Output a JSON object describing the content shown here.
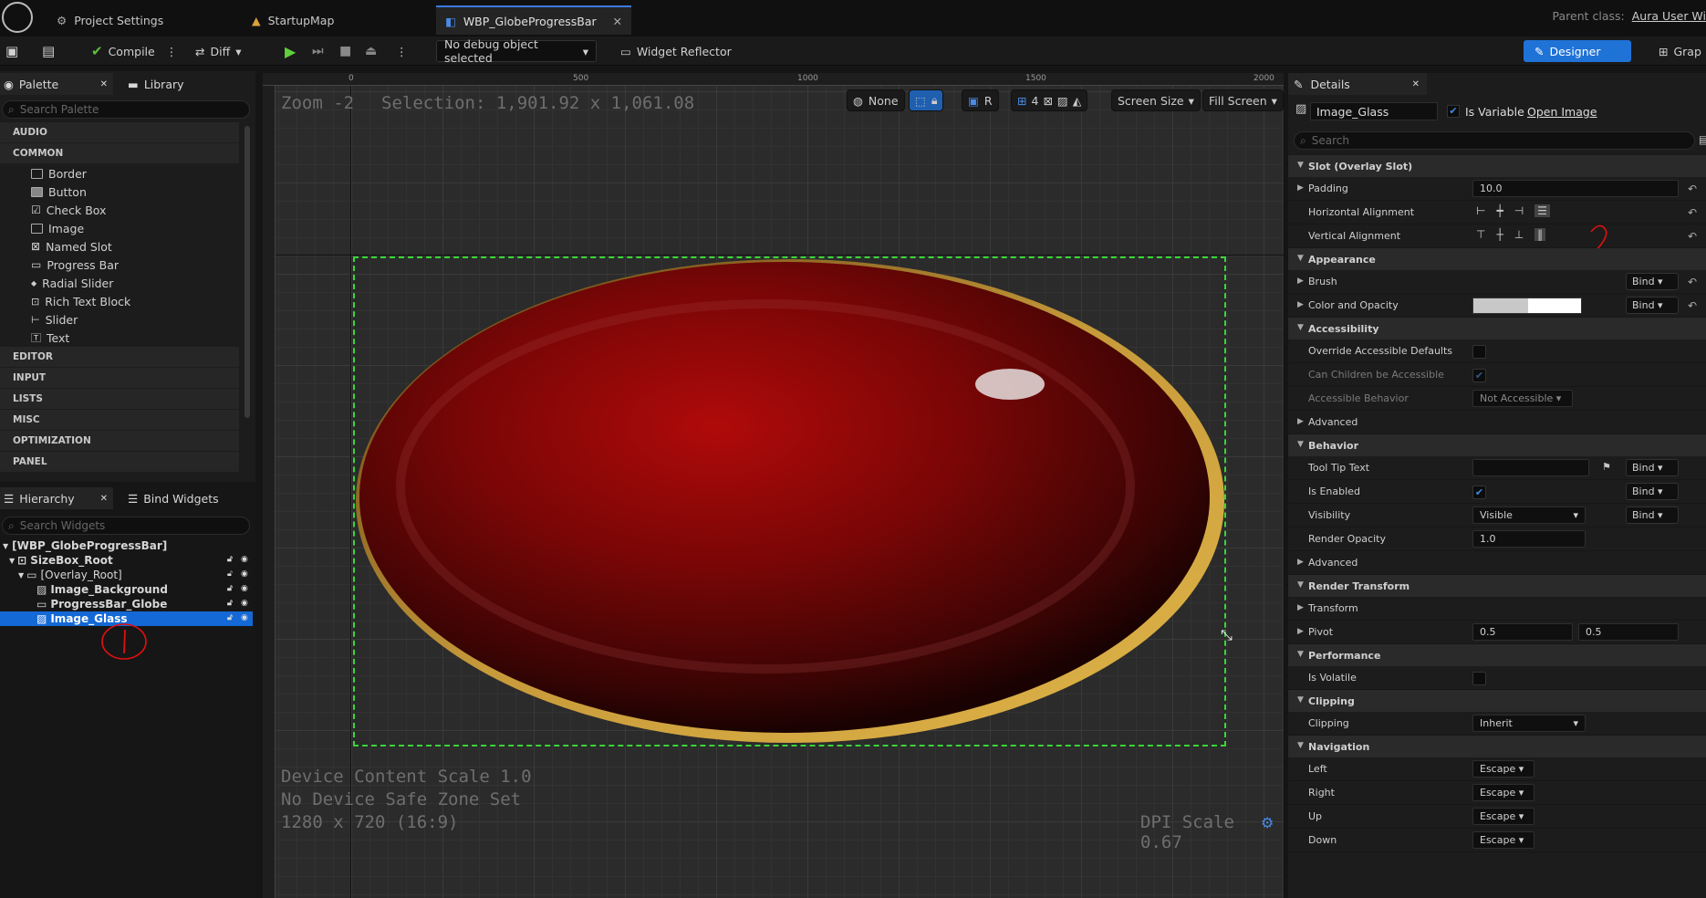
{
  "tabs": [
    {
      "label": "Project Settings"
    },
    {
      "label": "StartupMap"
    },
    {
      "label": "WBP_GlobeProgressBar"
    }
  ],
  "parent_class": {
    "label": "Parent class:",
    "value": "Aura User Wi"
  },
  "toolbar": {
    "compile": "Compile",
    "diff": "Diff",
    "debug_object": "No debug object selected",
    "widget_reflector": "Widget Reflector",
    "designer": "Designer",
    "graph": "Grap"
  },
  "palette": {
    "tab_label": "Palette",
    "library_label": "Library",
    "search_placeholder": "Search Palette",
    "categories": [
      "AUDIO",
      "COMMON",
      "EDITOR",
      "INPUT",
      "LISTS",
      "MISC",
      "OPTIMIZATION",
      "PANEL"
    ],
    "common_items": [
      "Border",
      "Button",
      "Check Box",
      "Image",
      "Named Slot",
      "Progress Bar",
      "Radial Slider",
      "Rich Text Block",
      "Slider",
      "Text"
    ]
  },
  "hierarchy": {
    "tab_label": "Hierarchy",
    "bind_widgets_label": "Bind Widgets",
    "search_placeholder": "Search Widgets",
    "items": [
      "[WBP_GlobeProgressBar]",
      "SizeBox_Root",
      "[Overlay_Root]",
      "Image_Background",
      "ProgressBar_Globe",
      "Image_Glass"
    ]
  },
  "viewport": {
    "zoom": "Zoom -2",
    "selection": "Selection: 1,901.92 x 1,061.08",
    "none_label": "None",
    "r_label": "R",
    "grid_count": "4",
    "screen_size": "Screen Size",
    "fill_screen": "Fill Screen",
    "ruler_marks": [
      "0",
      "500",
      "1000",
      "1500",
      "2000"
    ],
    "device_scale": "Device Content Scale 1.0",
    "safe_zone": "No Device Safe Zone Set",
    "resolution": "1280 x 720 (16:9)",
    "dpi_scale": "DPI Scale 0.67"
  },
  "details": {
    "tab_label": "Details",
    "widget_name": "Image_Glass",
    "is_variable": "Is Variable",
    "open_image": "Open Image",
    "search_placeholder": "Search",
    "sections": {
      "slot": "Slot (Overlay Slot)",
      "appearance": "Appearance",
      "accessibility": "Accessibility",
      "behavior": "Behavior",
      "render_transform": "Render Transform",
      "performance": "Performance",
      "clipping": "Clipping",
      "navigation": "Navigation"
    },
    "padding": {
      "label": "Padding",
      "value": "10.0"
    },
    "h_align": "Horizontal Alignment",
    "v_align": "Vertical Alignment",
    "brush": "Brush",
    "color_opacity": "Color and Opacity",
    "bind": "Bind",
    "override_accessible": "Override Accessible Defaults",
    "can_children": "Can Children be Accessible",
    "accessible_behavior": {
      "label": "Accessible Behavior",
      "value": "Not Accessible"
    },
    "advanced": "Advanced",
    "tooltip": "Tool Tip Text",
    "is_enabled": "Is Enabled",
    "visibility": {
      "label": "Visibility",
      "value": "Visible"
    },
    "render_opacity": {
      "label": "Render Opacity",
      "value": "1.0"
    },
    "transform": "Transform",
    "pivot": {
      "label": "Pivot",
      "x": "0.5",
      "y": "0.5"
    },
    "is_volatile": "Is Volatile",
    "clipping_row": {
      "label": "Clipping",
      "value": "Inherit"
    },
    "nav": [
      {
        "label": "Left",
        "value": "Escape"
      },
      {
        "label": "Right",
        "value": "Escape"
      },
      {
        "label": "Up",
        "value": "Escape"
      },
      {
        "label": "Down",
        "value": "Escape"
      }
    ]
  },
  "colors": {
    "accent": "#1f72d6",
    "selection_green": "#39d639",
    "annotation_red": "#e01010"
  }
}
